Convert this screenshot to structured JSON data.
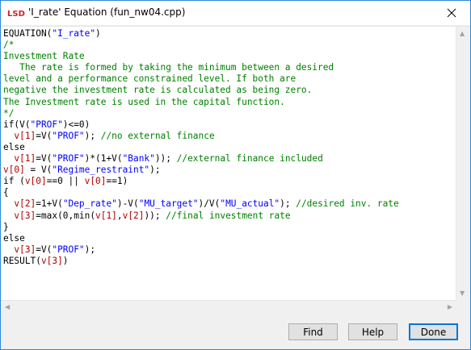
{
  "window": {
    "title": "'I_rate' Equation (fun_nw04.cpp)",
    "close_icon": "close-icon",
    "app_icon": "lsd-app-icon",
    "colors": {
      "string": "#0000ff",
      "variable": "#b00000",
      "comment": "#008000",
      "accent": "#0078d7"
    }
  },
  "editor": {
    "lines": [
      [
        {
          "t": "EQUATION(",
          "c": ""
        },
        {
          "t": "\"I_rate\"",
          "c": "str"
        },
        {
          "t": ")",
          "c": ""
        }
      ],
      [
        {
          "t": "/*",
          "c": "cmt"
        }
      ],
      [
        {
          "t": "Investment Rate",
          "c": "cmt"
        }
      ],
      [
        {
          "t": "   The rate is formed by taking the minimum between a desired",
          "c": "cmt"
        }
      ],
      [
        {
          "t": "level and a performance constrained level. If both are",
          "c": "cmt"
        }
      ],
      [
        {
          "t": "negative the investment rate is calculated as being zero.",
          "c": "cmt"
        }
      ],
      [
        {
          "t": "The Investment rate is used in the capital function.",
          "c": "cmt"
        }
      ],
      [
        {
          "t": "*/",
          "c": "cmt"
        }
      ],
      [
        {
          "t": "if(V(",
          "c": ""
        },
        {
          "t": "\"PROF\"",
          "c": "str"
        },
        {
          "t": ")<=0)",
          "c": ""
        }
      ],
      [
        {
          "t": "  ",
          "c": ""
        },
        {
          "t": "v[1]",
          "c": "var"
        },
        {
          "t": "=V(",
          "c": ""
        },
        {
          "t": "\"PROF\"",
          "c": "str"
        },
        {
          "t": "); ",
          "c": ""
        },
        {
          "t": "//no external finance",
          "c": "cmt"
        }
      ],
      [
        {
          "t": "else",
          "c": ""
        }
      ],
      [
        {
          "t": "  ",
          "c": ""
        },
        {
          "t": "v[1]",
          "c": "var"
        },
        {
          "t": "=V(",
          "c": ""
        },
        {
          "t": "\"PROF\"",
          "c": "str"
        },
        {
          "t": ")*(1+V(",
          "c": ""
        },
        {
          "t": "\"Bank\"",
          "c": "str"
        },
        {
          "t": ")); ",
          "c": ""
        },
        {
          "t": "//external finance included",
          "c": "cmt"
        }
      ],
      [
        {
          "t": "v[0]",
          "c": "var"
        },
        {
          "t": " = V(",
          "c": ""
        },
        {
          "t": "\"Regime_restraint\"",
          "c": "str"
        },
        {
          "t": ");",
          "c": ""
        }
      ],
      [
        {
          "t": "if (",
          "c": ""
        },
        {
          "t": "v[0]",
          "c": "var"
        },
        {
          "t": "==0 || ",
          "c": ""
        },
        {
          "t": "v[0]",
          "c": "var"
        },
        {
          "t": "==1)",
          "c": ""
        }
      ],
      [
        {
          "t": "{",
          "c": ""
        }
      ],
      [
        {
          "t": "  ",
          "c": ""
        },
        {
          "t": "v[2]",
          "c": "var"
        },
        {
          "t": "=1+V(",
          "c": ""
        },
        {
          "t": "\"Dep_rate\"",
          "c": "str"
        },
        {
          "t": ")-V(",
          "c": ""
        },
        {
          "t": "\"MU_target\"",
          "c": "str"
        },
        {
          "t": ")/V(",
          "c": ""
        },
        {
          "t": "\"MU_actual\"",
          "c": "str"
        },
        {
          "t": "); ",
          "c": ""
        },
        {
          "t": "//desired inv. rate",
          "c": "cmt"
        }
      ],
      [
        {
          "t": "  ",
          "c": ""
        },
        {
          "t": "v[3]",
          "c": "var"
        },
        {
          "t": "=max(0,min(",
          "c": ""
        },
        {
          "t": "v[1]",
          "c": "var"
        },
        {
          "t": ",",
          "c": ""
        },
        {
          "t": "v[2]",
          "c": "var"
        },
        {
          "t": ")); ",
          "c": ""
        },
        {
          "t": "//final investment rate",
          "c": "cmt"
        }
      ],
      [
        {
          "t": "}",
          "c": ""
        }
      ],
      [
        {
          "t": "else",
          "c": ""
        }
      ],
      [
        {
          "t": "  ",
          "c": ""
        },
        {
          "t": "v[3]",
          "c": "var"
        },
        {
          "t": "=V(",
          "c": ""
        },
        {
          "t": "\"PROF\"",
          "c": "str"
        },
        {
          "t": ");",
          "c": ""
        }
      ],
      [
        {
          "t": "RESULT(",
          "c": ""
        },
        {
          "t": "v[3]",
          "c": "var"
        },
        {
          "t": ")",
          "c": ""
        }
      ]
    ]
  },
  "buttons": {
    "find": "Find",
    "help": "Help",
    "done": "Done"
  }
}
